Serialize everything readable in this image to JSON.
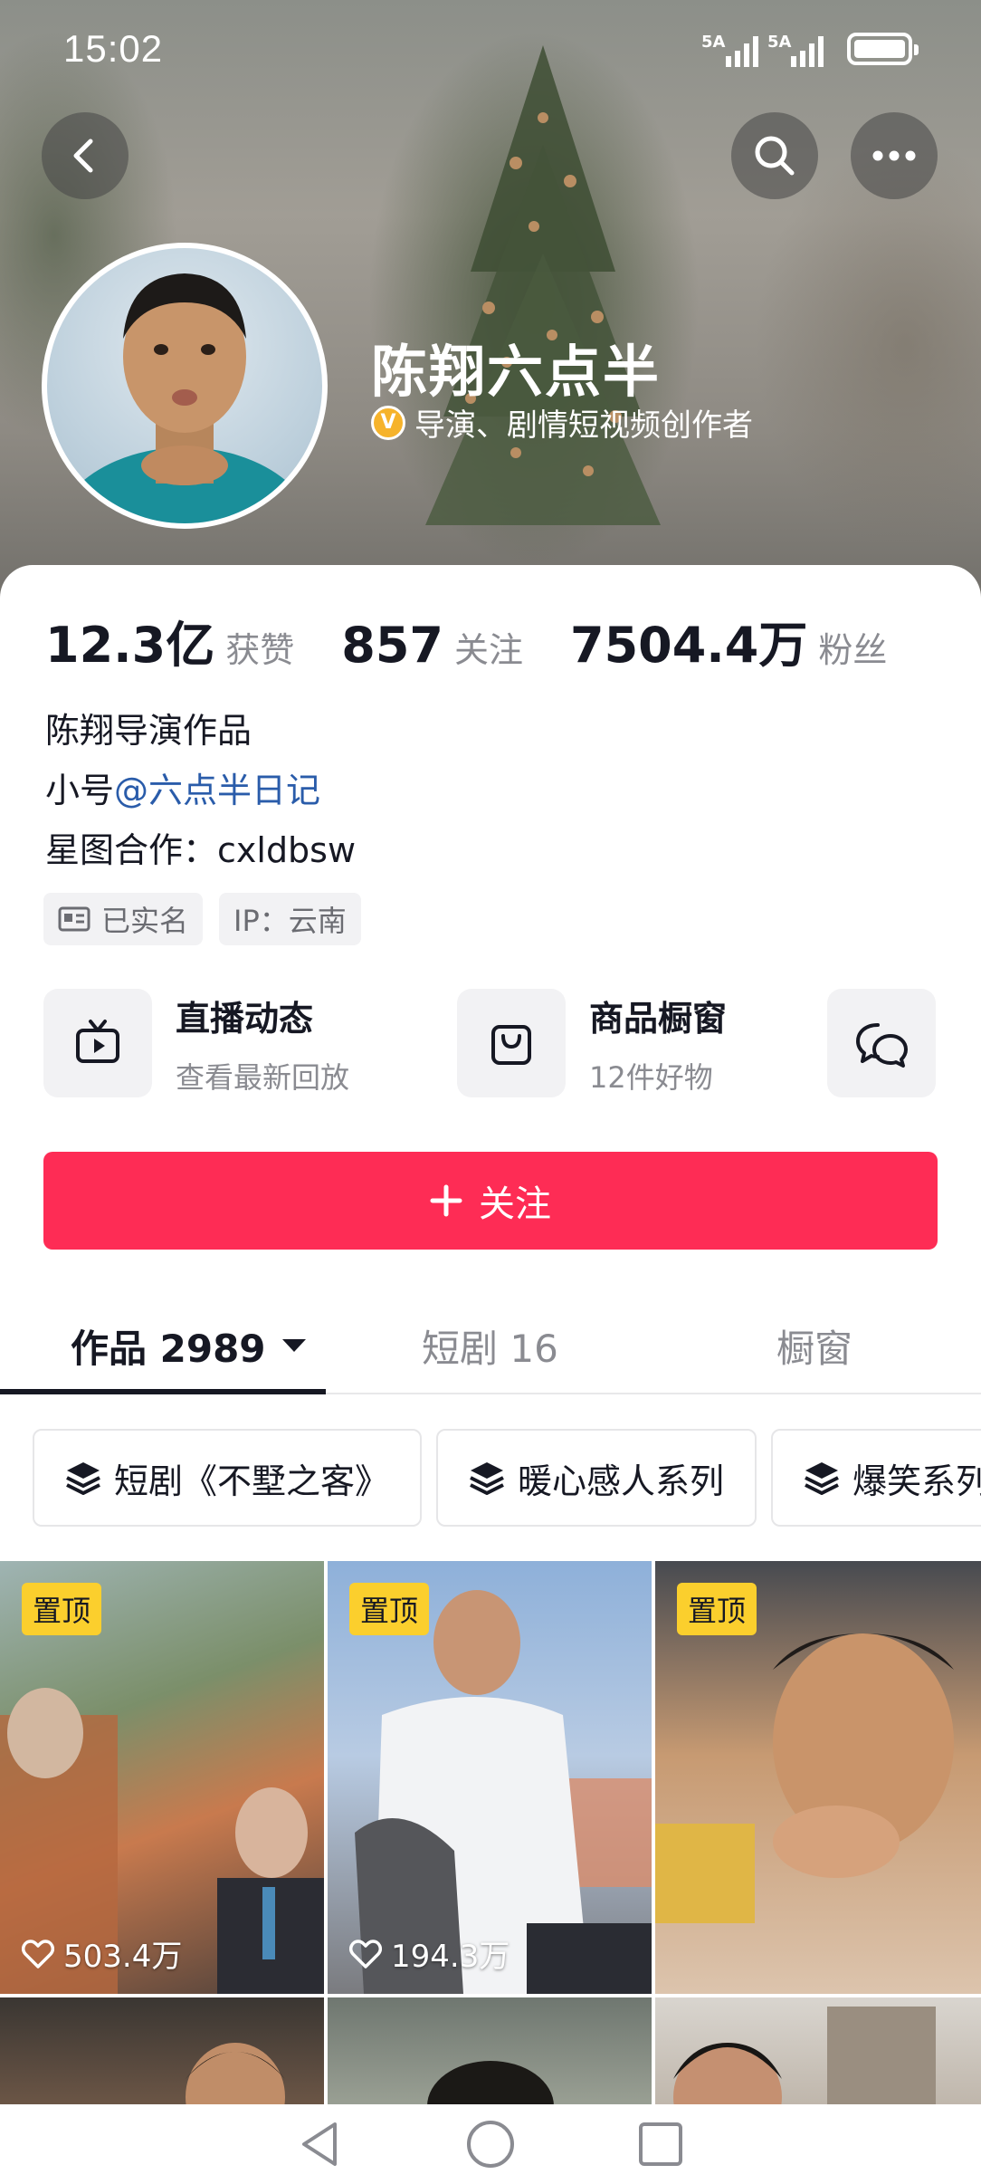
{
  "status_bar": {
    "time": "15:02",
    "signal1": "5A",
    "signal2": "5A"
  },
  "header": {
    "back_icon": "chevron-left-icon",
    "search_icon": "search-icon",
    "more_icon": "more-icon"
  },
  "profile": {
    "name": "陈翔六点半",
    "verified_label": "导演、剧情短视频创作者",
    "stats": [
      {
        "value": "12.3亿",
        "label": "获赞"
      },
      {
        "value": "857",
        "label": "关注"
      },
      {
        "value": "7504.4万",
        "label": "粉丝"
      }
    ],
    "bio_line1": "陈翔导演作品",
    "bio_line2_prefix": "小号",
    "bio_line2_link": "@六点半日记",
    "bio_line3": "星图合作：cxldbsw",
    "tags": [
      {
        "label": "已实名",
        "icon": "id-card-icon"
      },
      {
        "label": "IP：云南",
        "icon": ""
      }
    ]
  },
  "entries": {
    "live": {
      "title": "直播动态",
      "subtitle": "查看最新回放"
    },
    "shop": {
      "title": "商品橱窗",
      "subtitle": "12件好物"
    }
  },
  "follow_button": {
    "label": "关注"
  },
  "tabs": [
    {
      "label": "作品 2989"
    },
    {
      "label": "短剧 16"
    },
    {
      "label": "橱窗"
    }
  ],
  "collections": [
    {
      "label": "短剧《不墅之客》"
    },
    {
      "label": "暖心感人系列"
    },
    {
      "label": "爆笑系列"
    }
  ],
  "videos": [
    {
      "pinned": "置顶",
      "likes": "503.4万"
    },
    {
      "pinned": "置顶",
      "likes": "194.3万"
    },
    {
      "pinned": "置顶",
      "likes": ""
    }
  ],
  "colors": {
    "accent": "#fe2c55",
    "pin_badge": "#fbcf2d",
    "link": "#2a5caa"
  }
}
